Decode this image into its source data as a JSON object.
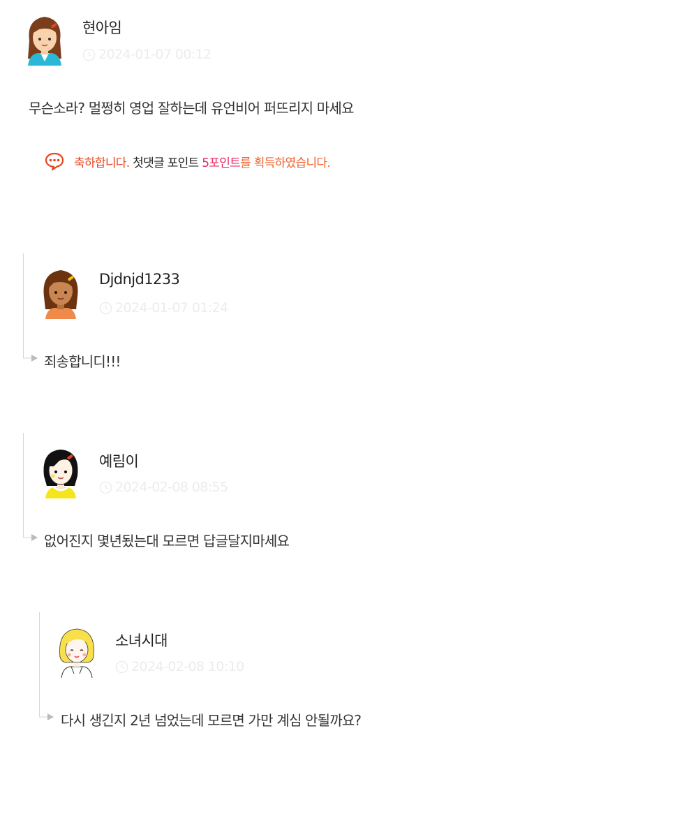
{
  "comments": [
    {
      "author": "현아임",
      "timestamp": "2024-01-07 00:12",
      "text": "무슨소라? 멀쩡히 영업 잘하는데 유언비어 퍼뜨리지 마세요",
      "notice": {
        "part1": "축하합니다.",
        "part2": "첫댓글 포인트",
        "part3": "5포인트",
        "part4": "를 획득하였습니다."
      }
    },
    {
      "author": "Djdnjd1233",
      "timestamp": "2024-01-07 01:24",
      "text": "죄송합니디!!!"
    },
    {
      "author": "예림이",
      "timestamp": "2024-02-08 08:55",
      "text": "없어진지 몇년됬는대 모르면 답글달지마세요"
    },
    {
      "author": "소녀시대",
      "timestamp": "2024-02-08 10:10",
      "text": "다시 생긴지 2년 넘었는데 모르면 가만 계심 안될까요?"
    }
  ],
  "icons": {
    "clock": "clock-icon",
    "notice": "speech-bubble-icon",
    "reply": "reply-arrow-icon"
  },
  "colors": {
    "notice_red": "#e8441d",
    "notice_pink": "#e8245f",
    "timestamp": "#ececec",
    "rail": "#d6d6d6"
  }
}
